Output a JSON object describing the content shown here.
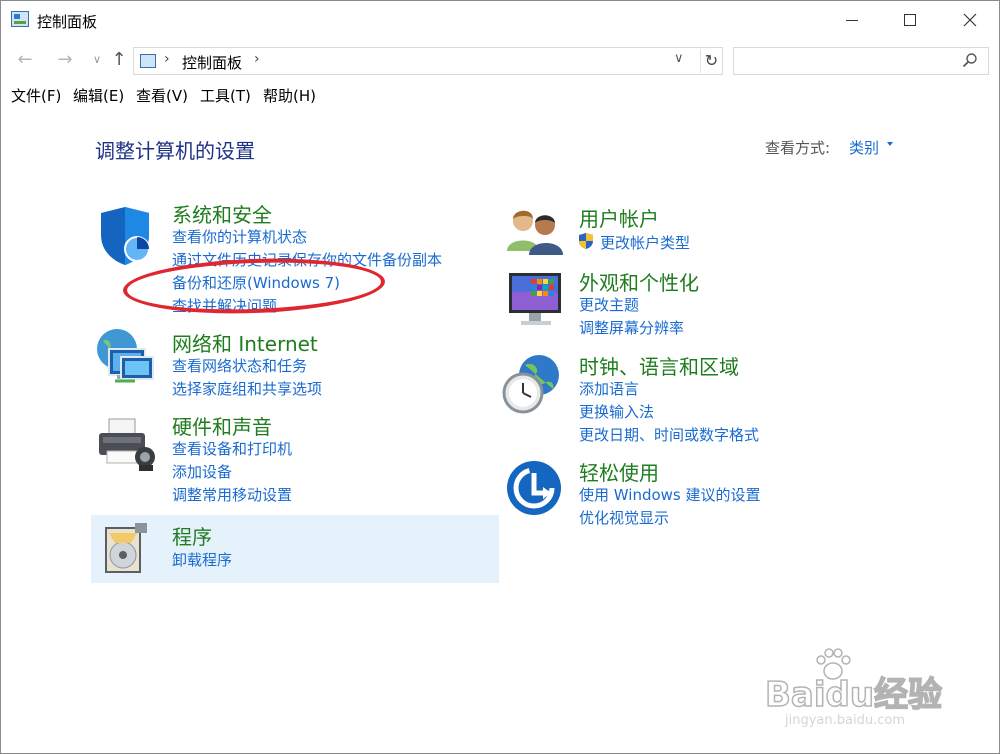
{
  "window": {
    "title": "控制面板"
  },
  "nav": {
    "back_glyph": "←",
    "forward_glyph": "→",
    "recent_glyph": "∨",
    "up_glyph": "↑",
    "address_sep": "›",
    "address_text": "控制面板",
    "address_sep_after": "›",
    "dropdown_glyph": "∨",
    "refresh_glyph": "↻",
    "search_placeholder": "",
    "search_icon_glyph": "⚲"
  },
  "menu": [
    {
      "label": "文件(F)"
    },
    {
      "label": "编辑(E)"
    },
    {
      "label": "查看(V)"
    },
    {
      "label": "工具(T)"
    },
    {
      "label": "帮助(H)"
    }
  ],
  "page": {
    "title": "调整计算机的设置",
    "view_label": "查看方式:",
    "view_value": "类别"
  },
  "categories": {
    "system_security": {
      "title": "系统和安全",
      "links": [
        "查看你的计算机状态",
        "通过文件历史记录保存你的文件备份副本",
        "备份和还原(Windows 7)",
        "查找并解决问题"
      ]
    },
    "network": {
      "title": "网络和 Internet",
      "links": [
        "查看网络状态和任务",
        "选择家庭组和共享选项"
      ]
    },
    "hardware": {
      "title": "硬件和声音",
      "links": [
        "查看设备和打印机",
        "添加设备",
        "调整常用移动设置"
      ]
    },
    "programs": {
      "title": "程序",
      "links": [
        "卸载程序"
      ]
    },
    "user_accounts": {
      "title": "用户帐户",
      "links": [
        "更改帐户类型"
      ]
    },
    "appearance": {
      "title": "外观和个性化",
      "links": [
        "更改主题",
        "调整屏幕分辨率"
      ]
    },
    "clock_region": {
      "title": "时钟、语言和区域",
      "links": [
        "添加语言",
        "更换输入法",
        "更改日期、时间或数字格式"
      ]
    },
    "ease_of_access": {
      "title": "轻松使用",
      "links": [
        "使用 Windows 建议的设置",
        "优化视觉显示"
      ]
    }
  },
  "watermark": {
    "brand": "Baidu经验",
    "url": "jingyan.baidu.com"
  },
  "colors": {
    "category_title": "#1f7d1f",
    "link": "#1a6bd1",
    "page_title": "#1e3287",
    "annotation": "#e0262f",
    "programs_highlight": "#e5f1fb"
  }
}
